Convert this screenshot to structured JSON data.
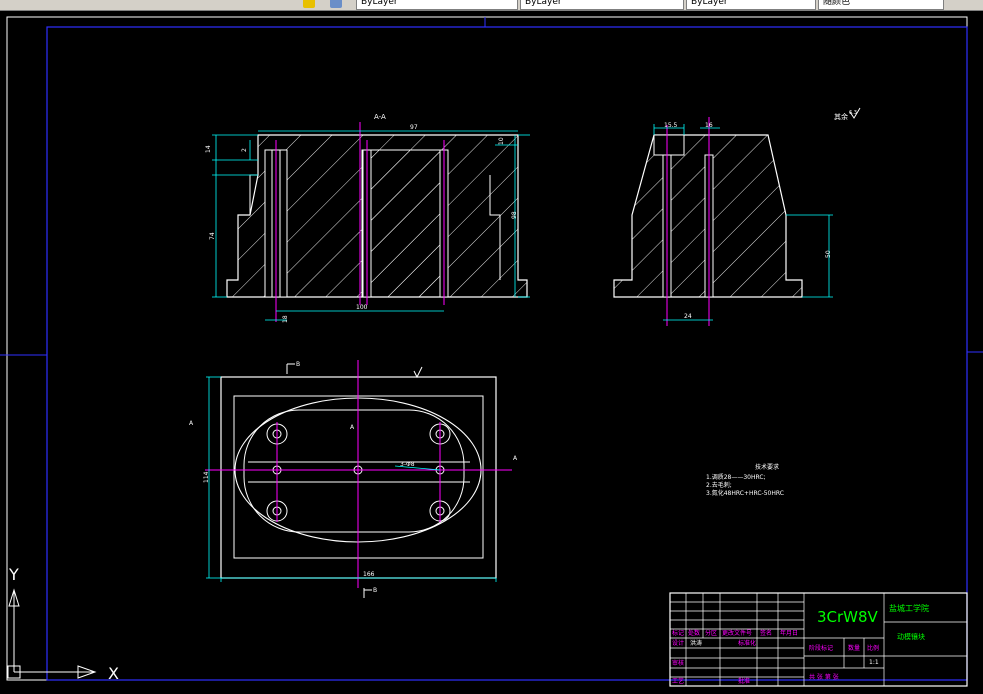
{
  "toolbar": {
    "layer_combo": "ByLayer",
    "linetype_combo": "ByLayer",
    "lineweight_combo": "ByLayer",
    "plotstyle_combo": "随颜色"
  },
  "drawing": {
    "section_label": "A-A",
    "roughness_note": "其余",
    "roughness_symbol": "6.3",
    "dims_front": {
      "top_width": "97",
      "h14": "14",
      "h2": "2",
      "h10": "10",
      "h74": "74",
      "h98": "98",
      "w100": "100",
      "d18": "18"
    },
    "dims_side": {
      "w15_5": "15.5",
      "w16": "16",
      "h50": "50",
      "w24": "24"
    },
    "dims_plan": {
      "height": "114",
      "width": "166",
      "hole_note": "3-Φ8"
    },
    "view_markers": {
      "B": "B",
      "A": "A"
    },
    "notes": {
      "title": "技术要求",
      "lines": [
        "1.调质28——30HRC;",
        "2.去毛刺;",
        "3.氮化48HRC+HRC-50HRC"
      ]
    },
    "title_block": {
      "material": "3CrW8V",
      "school": "盐城工学院",
      "part_name": "动模镶块",
      "scale_label": "比例",
      "scale_value": "1:1",
      "qty_label": "数量",
      "stage_label": "阶段标记",
      "row_labels": [
        "标记",
        "处数",
        "分区",
        "更改文件号",
        "签名",
        "年月日"
      ],
      "design_label": "设计",
      "designer": "洪涛",
      "std_label": "标准化",
      "review_label": "审核",
      "process_label": "工艺",
      "approve_label": "批准",
      "sheets_label": "共 张 第 张"
    },
    "ucs": {
      "x": "X",
      "y": "Y"
    }
  },
  "colors": {
    "background": "#000000",
    "outline": "#ffffff",
    "dimension": "#00ffff",
    "centerline": "#ff00ff",
    "border": "#0000ff",
    "title_text": "#00ff00",
    "note_text": "#ffffff"
  }
}
